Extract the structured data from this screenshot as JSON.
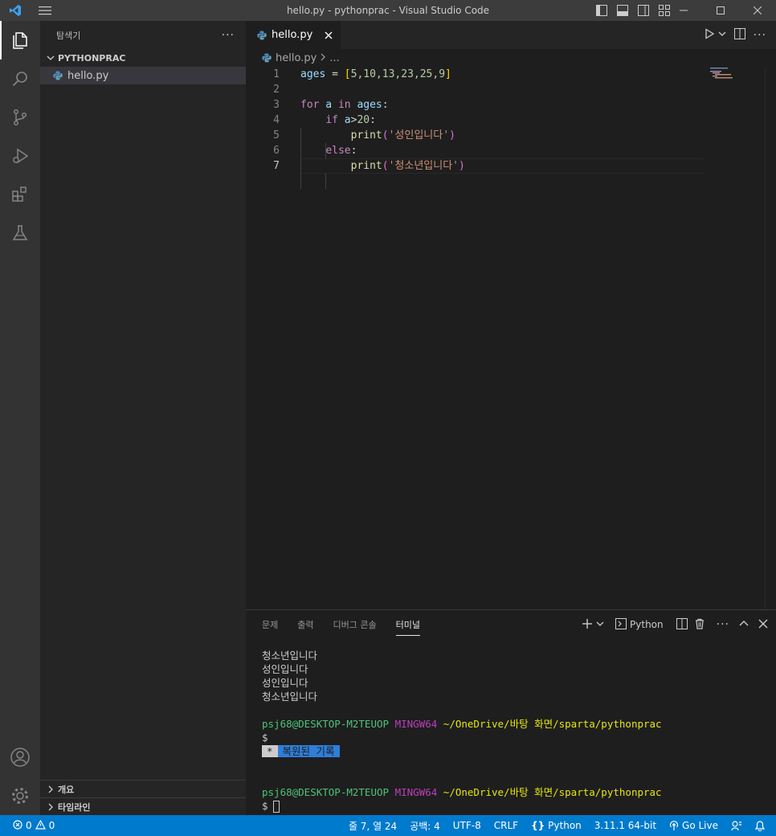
{
  "window": {
    "title": "hello.py - pythonprac - Visual Studio Code"
  },
  "sidebar": {
    "title": "탐색기",
    "folder": "PYTHONPRAC",
    "files": [
      {
        "name": "hello.py"
      }
    ],
    "bottom_sections": [
      "개요",
      "타임라인"
    ]
  },
  "editor": {
    "tab_label": "hello.py",
    "breadcrumb_file": "hello.py",
    "breadcrumb_more": "...",
    "line_numbers": [
      "1",
      "2",
      "3",
      "4",
      "5",
      "6",
      "7"
    ],
    "current_line": "7"
  },
  "code": {
    "l1": {
      "var": "ages",
      "eq": " = ",
      "open": "[",
      "nums": "5,10,13,23,25,9",
      "close": "]"
    },
    "l3": {
      "kw_for": "for",
      "var": " a ",
      "kw_in": "in",
      "iter": " ages",
      "colon": ":"
    },
    "l4": {
      "kw_if": "if",
      "var": " a",
      "op": ">",
      "num": "20",
      "colon": ":"
    },
    "l5": {
      "fn": "print",
      "open": "(",
      "str": "'성인입니다'",
      "close": ")"
    },
    "l6": {
      "kw_else": "else",
      "colon": ":"
    },
    "l7": {
      "fn": "print",
      "open": "(",
      "str": "'청소년입니다'",
      "close": ")"
    }
  },
  "panel": {
    "tabs": [
      "문제",
      "출력",
      "디버그 콘솔",
      "터미널"
    ],
    "active_tab": "터미널",
    "terminal_profile": "Python",
    "output_lines": [
      "청소년입니다",
      "성인입니다",
      "성인입니다",
      "청소년입니다"
    ],
    "prompt": {
      "user_host": "psj68@DESKTOP-M2TEUOP",
      "shell": "MINGW64",
      "path": "~/OneDrive/바탕 화면/sparta/pythonprac",
      "symbol": "$"
    },
    "restored_star": "*",
    "restored_text": "복원된 기록"
  },
  "statusbar": {
    "errors": "0",
    "warnings": "0",
    "position": "줄 7, 열 24",
    "spaces": "공백: 4",
    "encoding": "UTF-8",
    "eol": "CRLF",
    "language": "Python",
    "interpreter": "3.11.1 64-bit",
    "golive": "Go Live"
  },
  "colors": {
    "accent": "#007acc",
    "activity_bar": "#333333",
    "sidebar": "#252526",
    "editor_bg": "#1e1e1e"
  }
}
